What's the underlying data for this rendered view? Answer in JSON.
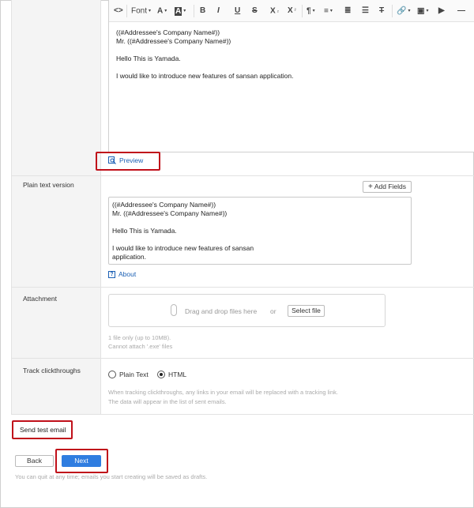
{
  "toolbar": {
    "code": "<>",
    "font": "Font",
    "font_size": "A",
    "bg_color": "A",
    "bold": "B",
    "italic": "I",
    "underline": "U",
    "strike": "S",
    "subscript": "X",
    "subscript_mark": "₂",
    "superscript": "X",
    "superscript_mark": "²",
    "paragraph": "¶",
    "align": "≡",
    "ordered_list": "≣",
    "unordered_list": "☰",
    "clear_format": "T",
    "link": "🔗",
    "image": "▣",
    "video": "▶",
    "hr": "—",
    "dropdown_glyph": "▾"
  },
  "editor": {
    "lines": [
      "((#Addressee's Company Name#))",
      "Mr. ((#Addressee's Company Name#))",
      "",
      "Hello This is Yamada.",
      "",
      "I would like to introduce new features of sansan application."
    ]
  },
  "preview": {
    "label": "Preview"
  },
  "plain_text": {
    "label": "Plain text version",
    "add_fields": "Add Fields",
    "add_fields_plus": "+",
    "lines": [
      "((#Addressee's Company Name#))",
      "Mr. ((#Addressee's Company Name#))",
      "",
      "Hello This is Yamada.",
      "",
      "I would like to introduce new features of sansan",
      "application."
    ],
    "about": "About",
    "about_mark": "?"
  },
  "attachment": {
    "label": "Attachment",
    "drop_text": "Drag and drop files here",
    "or": "or",
    "select_file": "Select file",
    "note1": "1 file only (up to 10MB).",
    "note2": "Cannot attach '.exe' files"
  },
  "tracking": {
    "label": "Track clickthroughs",
    "options": [
      "Plain Text",
      "HTML"
    ],
    "selected": "HTML",
    "note1": "When tracking clickthroughs, any links in your email will be replaced with a tracking link.",
    "note2": "The data will appear in the list of sent emails."
  },
  "send_test": {
    "label": "Send test email"
  },
  "buttons": {
    "back": "Back",
    "next": "Next"
  },
  "footer_note": "You can quit at any time; emails you start creating will be saved as drafts.",
  "colors": {
    "highlight": "#c0101a",
    "link": "#1a5fb4",
    "primary": "#2f7de0"
  }
}
